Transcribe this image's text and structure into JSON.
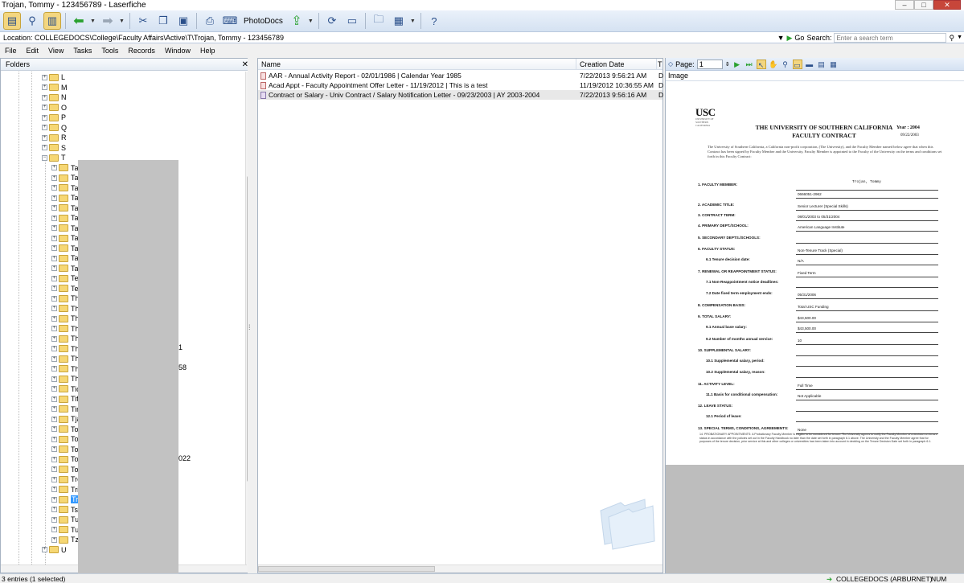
{
  "window": {
    "title": "Trojan, Tommy - 123456789 - Laserfiche",
    "minimize": "–",
    "maximize": "□",
    "close": "✕"
  },
  "toolbar": {
    "photodocs_label": "PhotoDocs"
  },
  "location": {
    "label": "Location:",
    "path": "COLLEGEDOCS\\College\\Faculty Affairs\\Active\\T\\Trojan, Tommy - 123456789",
    "go_label": "Go",
    "search_label": "Search:",
    "search_placeholder": "Enter a search term"
  },
  "menu": [
    "File",
    "Edit",
    "View",
    "Tasks",
    "Tools",
    "Records",
    "Window",
    "Help"
  ],
  "folders": {
    "header": "Folders",
    "close": "✕",
    "top_level": [
      "L",
      "M",
      "N",
      "O",
      "P",
      "Q",
      "R",
      "S",
      "T"
    ],
    "t_children": [
      "Tak",
      "Tak",
      "Tak",
      "Tan",
      "Tan",
      "Tan",
      "Tan",
      "Tan",
      "Tar",
      "Tav",
      "Tay",
      "Teh",
      "Ter",
      "Tha",
      "The",
      "Thi",
      "Tho",
      "Tho",
      "Tho",
      "Tho",
      "Thu",
      "Thu",
      "Tic",
      "Tiff",
      "Tim",
      "Tja",
      "Too",
      "Tor",
      "Tor",
      "Tov",
      "Toy",
      "Tre",
      "Tric",
      "Tro",
      "Tse",
      "Tur",
      "Tur",
      "Tzo"
    ],
    "after": [
      "U"
    ],
    "fragments": {
      "a": "1",
      "b": "58",
      "c": "022"
    }
  },
  "list": {
    "columns": {
      "name": "Name",
      "created": "Creation Date",
      "type": "T"
    },
    "rows": [
      {
        "name": "AAR - Annual Activity Report - 02/01/1986 | Calendar Year 1985",
        "created": "7/22/2013 9:56:21 AM",
        "type": "D"
      },
      {
        "name": "Acad Appt - Faculty Appointment Offer Letter - 11/19/2012 | This is a test",
        "created": "11/19/2012 10:36:55 AM",
        "type": "D"
      },
      {
        "name": "Contract or Salary - Univ Contract / Salary Notification Letter - 09/23/2003 | AY 2003-2004",
        "created": "7/22/2013 9:56:16 AM",
        "type": "D"
      }
    ]
  },
  "viewer": {
    "page_label": "Page:",
    "page_value": "1",
    "image_label": "Image",
    "doc": {
      "usc": "USC",
      "usc_sub": "UNIVERSITY OF SOUTHERN CALIFORNIA",
      "title_line1": "THE UNIVERSITY OF SOUTHERN CALIFORNIA",
      "title_line2": "FACULTY CONTRACT",
      "year": "Year : 2004",
      "date": "09/22/2003",
      "intro": "The University of Southern California, a California non-profit corporation, (The University), and the Faculty Member named below agree that when this Contract has been signed by Faculty Member and the University, Faculty Member is appointed to the Faculty of the University on the terms and conditions set forth in this Faculty Contract:",
      "fields": [
        {
          "label": "1.  FACULTY MEMBER:",
          "value": "Trojan, Tommy",
          "value2": "0666051-2962"
        },
        {
          "label": "2.  ACADEMIC TITLE:",
          "value": "Senior Lecturer (Special Skills)"
        },
        {
          "label": "3.  CONTRACT TERM:",
          "value": "08/01/2003  to  05/31/2004"
        },
        {
          "label": "4.  PRIMARY DEPT./SCHOOL:",
          "value": "American Language Institute"
        },
        {
          "label": "5.  SECONDARY DEPTS./SCHOOLS:",
          "value": ""
        },
        {
          "label": "6.  FACULTY STATUS:",
          "value": "Non-Tenure Track (Special)"
        },
        {
          "label": "6.1  Tenure decision date:",
          "value": "N/A"
        },
        {
          "label": "7.  RENEWAL OR REAPPOINTMENT STATUS:",
          "value": "Fixed Term"
        },
        {
          "label": "7.1  Non-Reappointment notice deadlines:",
          "value": ""
        },
        {
          "label": "7.2  Date fixed term employment ends:",
          "value": "05/31/2006"
        },
        {
          "label": "8.  COMPENSATION BASIS:",
          "value": "Total USC Funding"
        },
        {
          "label": "9.  TOTAL SALARY:",
          "value": "$43,500.00"
        },
        {
          "label": "9.1  Annual base salary:",
          "value": "$43,500.00"
        },
        {
          "label": "9.2  Number of months annual service:",
          "value": "10"
        },
        {
          "label": "10.  SUPPLEMENTAL SALARY:",
          "value": ""
        },
        {
          "label": "10.1  Supplemental salary, period:",
          "value": ""
        },
        {
          "label": "10.2  Supplemental salary, reason:",
          "value": ""
        },
        {
          "label": "11.  ACTIVITY LEVEL:",
          "value": "Full Time"
        },
        {
          "label": "11.1  Basis for conditional compensation:",
          "value": "Not Applicable"
        },
        {
          "label": "12.  LEAVE STATUS:",
          "value": ""
        },
        {
          "label": "12.1  Period of leave:",
          "value": ""
        },
        {
          "label": "13.  SPECIAL TERMS, CONDITIONS, AGREEMENTS:",
          "value": "None"
        }
      ],
      "fine_print": "14.  PROBATIONARY APPOINTMENTS:  A Probationary Faculty Member is eligible to be considered for tenure. The University agrees to notify the Faculty Member of a decision on tenure status in accordance with the policies set out in the Faculty Handbook no later than the date set forth in paragraph 6.1 above. The University and the Faculty Member agree that for purposes of the tenure decision, prior service at this and other colleges or universities has been taken into account in deciding on the Tenure Decision Date set forth in paragraph 6.1."
    }
  },
  "status": {
    "left": "3 entries (1 selected)",
    "connection": "COLLEGEDOCS (ARBURNET)",
    "num": "NUM"
  }
}
